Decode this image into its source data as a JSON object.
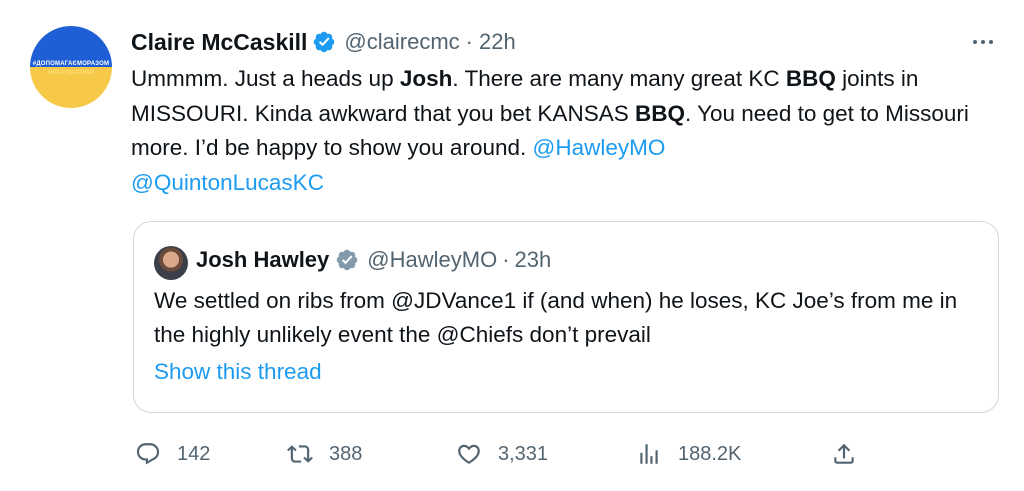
{
  "author": {
    "display_name": "Claire McCaskill",
    "handle": "@clairecmc",
    "dot": "·",
    "time": "22h",
    "avatar_text_line1": "#ДОПОМАГАЄМОРАЗОМ",
    "avatar_text_line2": "#HELPTOGETHER"
  },
  "tweet": {
    "t1": "Ummmm.  Just a heads up ",
    "t2": "Josh",
    "t3": ". There are many many great KC ",
    "t4": "BBQ",
    "t5": " joints in MISSOURI. Kinda awkward that you bet KANSAS ",
    "t6": "BBQ",
    "t7": ". You need to get to Missouri more. I’d be happy to show you around. ",
    "mention1": "@HawleyMO",
    "mention2": "@QuintonLucasKC"
  },
  "quoted": {
    "display_name": "Josh Hawley",
    "handle": "@HawleyMO",
    "dot": "·",
    "time": "23h",
    "text": "We settled on ribs from @JDVance1 if (and when) he loses, KC Joe’s from me in the highly unlikely event the @Chiefs don’t prevail",
    "show_thread": "Show this thread"
  },
  "actions": {
    "replies": "142",
    "retweets": "388",
    "likes": "3,331",
    "views": "188.2K"
  },
  "colors": {
    "accent": "#1d9bf0",
    "secondary_text": "#536471",
    "border": "#cfd9de",
    "avatar_blue": "#1f5fd6",
    "avatar_yellow": "#f7c948"
  },
  "icons": [
    "verified-badge-icon",
    "more-icon",
    "reply-icon",
    "retweet-icon",
    "like-icon",
    "views-icon",
    "share-icon"
  ]
}
